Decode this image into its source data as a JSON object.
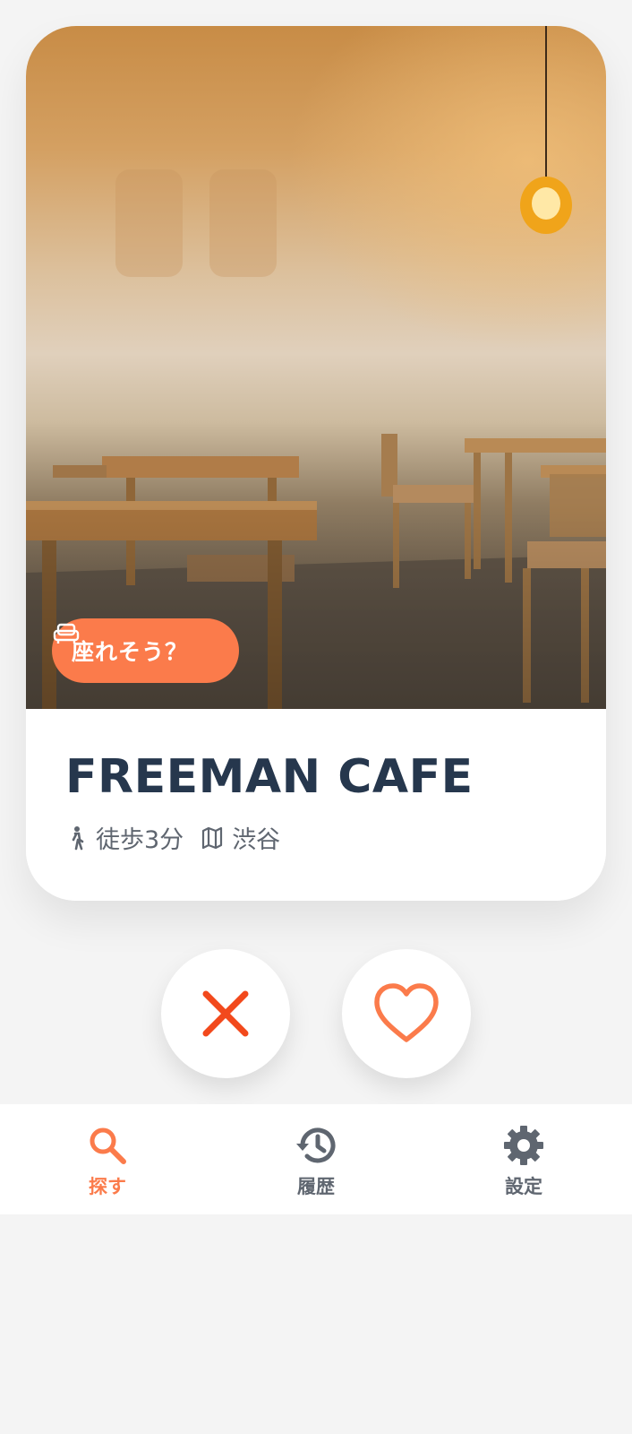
{
  "card": {
    "badge_label": "座れそう？",
    "cafe_name": "FREEMAN CAFE",
    "walk_time": "徒歩3分",
    "area": "渋谷"
  },
  "actions": {
    "skip_icon": "close-icon",
    "like_icon": "heart-icon"
  },
  "tabs": [
    {
      "label": "探す",
      "icon": "search-icon",
      "active": true
    },
    {
      "label": "履歴",
      "icon": "history-icon",
      "active": false
    },
    {
      "label": "設定",
      "icon": "gear-icon",
      "active": false
    }
  ],
  "colors": {
    "accent": "#fb7b4b",
    "skip": "#f2491c",
    "title": "#26374d",
    "muted": "#5f6670",
    "background": "#f4f4f4"
  }
}
